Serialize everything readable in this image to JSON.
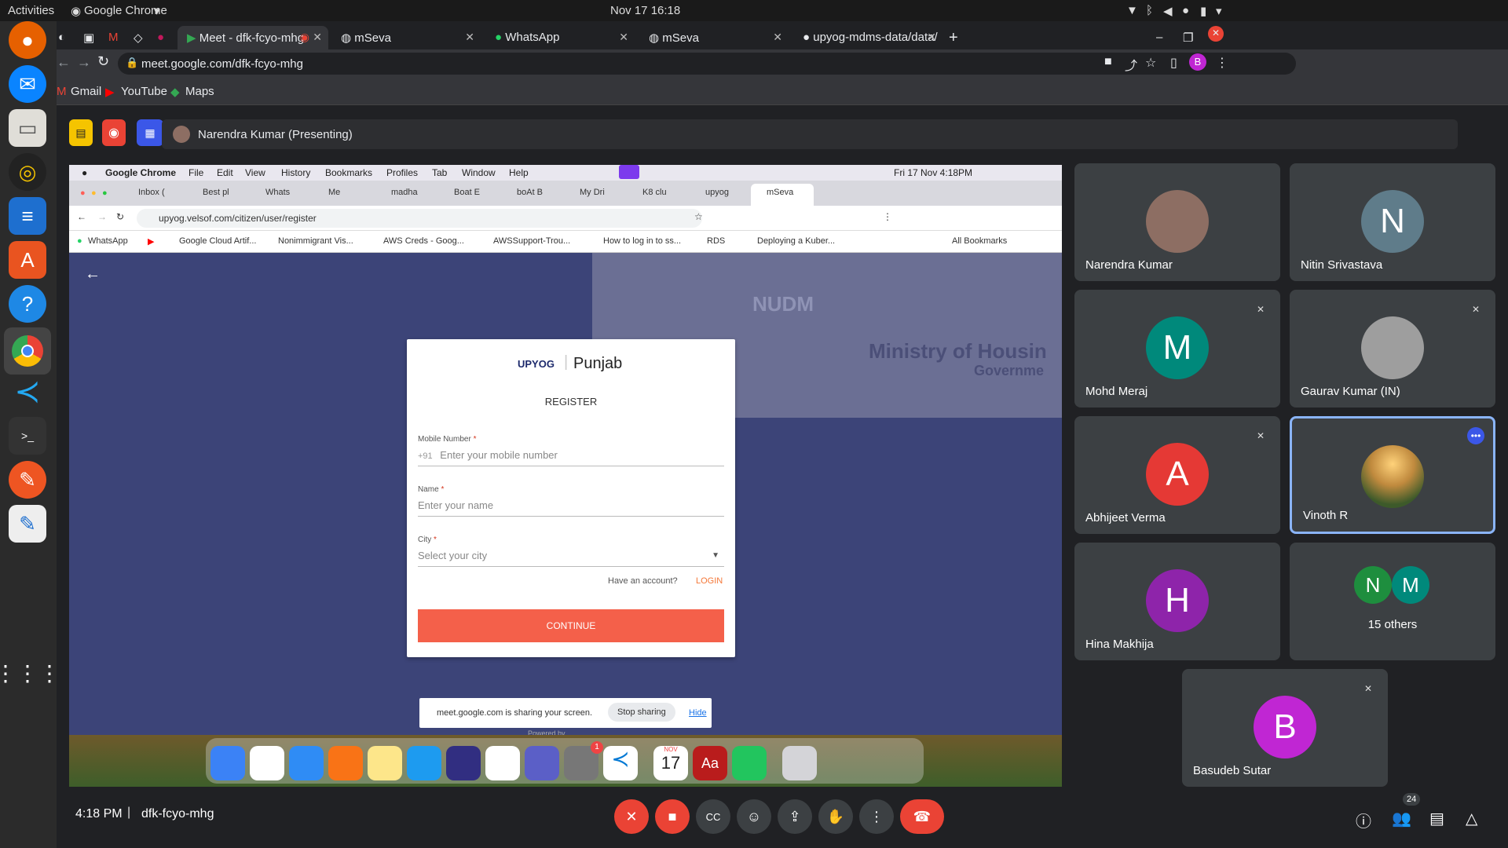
{
  "os": {
    "activities": "Activities",
    "app_menu": "Google Chrome",
    "clock": "Nov 17  16:18"
  },
  "dock": [
    "firefox-icon",
    "thunderbird-icon",
    "files-icon",
    "rhythmbox-icon",
    "writer-icon",
    "software-icon",
    "help-icon",
    "chrome-icon",
    "vscode-icon",
    "terminal-icon",
    "inkscape-icon",
    "text-editor-icon",
    "apps-grid-icon"
  ],
  "chrome": {
    "tabs": [
      {
        "label": "Meet - dfk-fcyo-mhg",
        "active": true
      },
      {
        "label": "mSeva"
      },
      {
        "label": "WhatsApp"
      },
      {
        "label": "mSeva"
      },
      {
        "label": "upyog-mdms-data/data/"
      }
    ],
    "url": "meet.google.com/dfk-fcyo-mhg",
    "bookmarks": [
      "Gmail",
      "YouTube",
      "Maps"
    ],
    "profile_letter": "B"
  },
  "meet": {
    "presenter": "Narendra Kumar (Presenting)",
    "time": "4:18 PM",
    "meeting_code": "dfk-fcyo-mhg",
    "people_count": "24",
    "participants": [
      {
        "name": "Narendra Kumar",
        "initial": "",
        "color": "#8d6e63",
        "muted": false
      },
      {
        "name": "Nitin Srivastava",
        "initial": "N",
        "color": "#5f7c8a",
        "muted": false
      },
      {
        "name": "Mohd Meraj",
        "initial": "M",
        "color": "#00897b",
        "muted": true
      },
      {
        "name": "Gaurav Kumar (IN)",
        "initial": "",
        "color": "#9e9e9e",
        "muted": true
      },
      {
        "name": "Abhijeet Verma",
        "initial": "A",
        "color": "#e53935",
        "muted": true
      },
      {
        "name": "Vinoth R",
        "initial": "",
        "color": "#c08a3e",
        "muted": false
      },
      {
        "name": "Hina Makhija",
        "initial": "H",
        "color": "#8e24aa",
        "muted": false
      },
      {
        "name": "15 others",
        "initial": "",
        "color": "",
        "muted": false
      },
      {
        "name": "Basudeb Sutar",
        "initial": "B",
        "color": "#c026d3",
        "muted": true
      }
    ],
    "others_initials": [
      "N",
      "M"
    ]
  },
  "shared": {
    "mac_menu": [
      "Google Chrome",
      "File",
      "Edit",
      "View",
      "History",
      "Bookmarks",
      "Profiles",
      "Tab",
      "Window",
      "Help"
    ],
    "mac_clock": "Fri 17 Nov  4:18PM",
    "tabs": [
      "Inbox (",
      "Best pl",
      "Whats",
      "Me",
      "madha",
      "Boat E",
      "boAt B",
      "My Dri",
      "K8 clu",
      "upyog",
      "mSeva"
    ],
    "url": "upyog.velsof.com/citizen/user/register",
    "bookmarks": [
      "WhatsApp",
      "",
      "Google Cloud Artif...",
      "Nonimmigrant Vis...",
      "AWS Creds - Goog...",
      "AWSSupport-Trou...",
      "How to log in to ss...",
      "RDS",
      "Deploying a Kuber..."
    ],
    "all_bookmarks": "All Bookmarks",
    "bg_text": [
      "NUDM",
      "Ministry of Housin",
      "Governme"
    ],
    "form": {
      "brand": "UPYOG",
      "city": "Punjab",
      "heading": "REGISTER",
      "mobile_label": "Mobile Number",
      "mobile_prefix": "+91",
      "mobile_placeholder": "Enter your mobile number",
      "name_label": "Name",
      "name_placeholder": "Enter your name",
      "city_label": "City",
      "city_placeholder": "Select your city",
      "have_account": "Have an account?",
      "login": "LOGIN",
      "continue": "CONTINUE",
      "powered": "Powered by"
    },
    "share_notice": "meet.google.com is sharing your screen.",
    "stop_sharing": "Stop sharing",
    "hide": "Hide",
    "calendar_day": "17",
    "calendar_month": "NOV",
    "dict_label": "Aa",
    "badge": "1"
  }
}
